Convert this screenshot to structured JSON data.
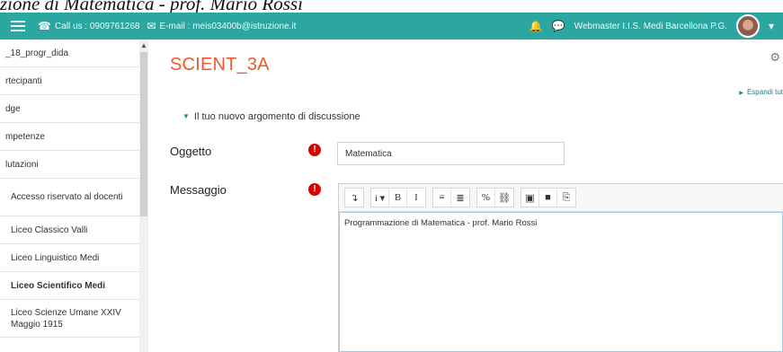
{
  "caption": "zione di Matematica - prof. Mario Rossi",
  "topbar": {
    "phone": "Call us : 0909761268",
    "email": "E-mail : meis03400b@istruzione.it",
    "user": "Webmaster I.I.S. Medi Barcellona P.G.",
    "accent_color": "#2ba6a1"
  },
  "sidebar": {
    "items": [
      {
        "label": "_18_progr_dida",
        "sub": false
      },
      {
        "label": "rtecipanti",
        "sub": false
      },
      {
        "label": "dge",
        "sub": false
      },
      {
        "label": "mpetenze",
        "sub": false
      },
      {
        "label": "lutazioni",
        "sub": false
      },
      {
        "label": "Accesso riservato al docenti",
        "sub": true
      },
      {
        "label": "Liceo Classico Valli",
        "sub": true
      },
      {
        "label": "Liceo Linguistico Medi",
        "sub": true
      },
      {
        "label": "Liceo Scientifico Medi",
        "sub": true
      },
      {
        "label": "Liceo Scienze Umane XXIV Maggio 1915",
        "sub": true
      }
    ]
  },
  "main": {
    "title": "SCIENT_3A",
    "expand_label": "Espandi tut",
    "section_label": "Il tuo nuovo argomento di discussione",
    "subject_label": "Oggetto",
    "subject_value": "Matematica",
    "message_label": "Messaggio",
    "message_text": "Programmazione di Matematica - prof. Mario Rossi"
  },
  "toolbar": {
    "buttons": [
      "↴",
      "i ▾",
      "B",
      "I",
      "≡",
      "≣",
      "%",
      "⛓",
      "▣",
      "■",
      "⎘"
    ]
  }
}
